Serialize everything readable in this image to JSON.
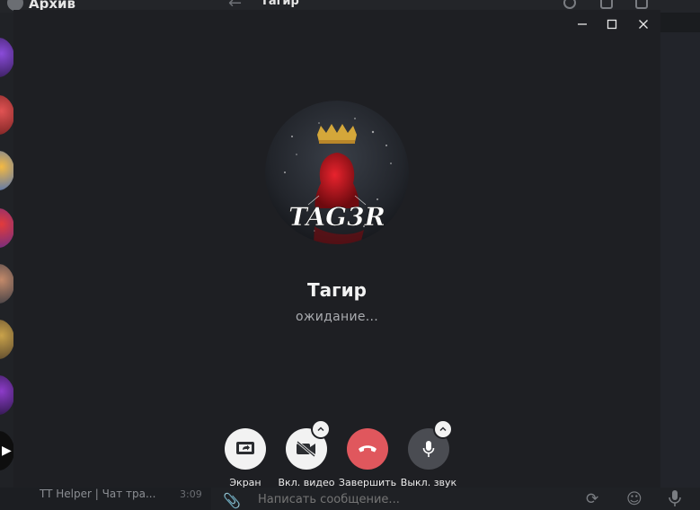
{
  "background": {
    "archive_label": "Архив",
    "chat_title": "Тагир",
    "chat_preview": "TT Helper | Чат тра...",
    "chat_preview_time": "3:09",
    "message_placeholder": "Написать сообщение..."
  },
  "window_controls": {
    "minimize": "—",
    "maximize": "▢",
    "close": "✕"
  },
  "call": {
    "avatar_text": "TAG3R",
    "name": "Тагир",
    "status": "ожидание..."
  },
  "controls": [
    {
      "label": "Экран",
      "icon": "screen-share-icon"
    },
    {
      "label": "Вкл. видео",
      "icon": "video-off-icon"
    },
    {
      "label": "Завершить",
      "icon": "hang-up-icon"
    },
    {
      "label": "Выкл. звук",
      "icon": "microphone-icon"
    }
  ],
  "colors": {
    "call_background": "#1e1f23",
    "end_call": "#e0575d",
    "light_button": "#f2f2f2",
    "dark_button": "#4a4c52"
  }
}
